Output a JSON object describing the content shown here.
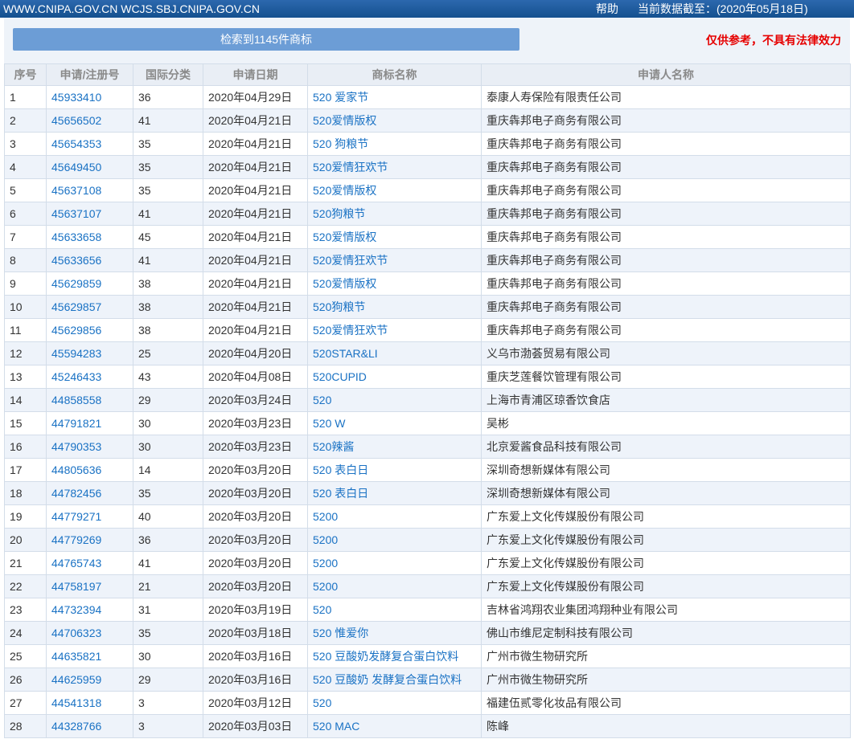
{
  "topbar": {
    "site_text": "WWW.CNIPA.GOV.CN WCJS.SBJ.CNIPA.GOV.CN",
    "help_label": "帮助",
    "data_date_label": "当前数据截至：(2020年05月18日)"
  },
  "toolbar": {
    "result_label": "检索到1145件商标",
    "disclaimer": "仅供参考，不具有法律效力"
  },
  "colors": {
    "topbar_top": "#2c68ae",
    "topbar_bottom": "#14508f",
    "button": "#6c9dd6",
    "disclaimer": "#e60000",
    "link": "#1a72c4",
    "row_alt": "#eef3fa"
  },
  "table": {
    "columns": [
      "序号",
      "申请/注册号",
      "国际分类",
      "申请日期",
      "商标名称",
      "申请人名称"
    ],
    "rows": [
      {
        "no": "1",
        "reg_no": "45933410",
        "intl_class": "36",
        "date": "2020年04月29日",
        "mark": "520 爱家节",
        "applicant": "泰康人寿保险有限责任公司"
      },
      {
        "no": "2",
        "reg_no": "45656502",
        "intl_class": "41",
        "date": "2020年04月21日",
        "mark": "520爱情版权",
        "applicant": "重庆犇邦电子商务有限公司"
      },
      {
        "no": "3",
        "reg_no": "45654353",
        "intl_class": "35",
        "date": "2020年04月21日",
        "mark": "520 狗粮节",
        "applicant": "重庆犇邦电子商务有限公司"
      },
      {
        "no": "4",
        "reg_no": "45649450",
        "intl_class": "35",
        "date": "2020年04月21日",
        "mark": "520爱情狂欢节",
        "applicant": "重庆犇邦电子商务有限公司"
      },
      {
        "no": "5",
        "reg_no": "45637108",
        "intl_class": "35",
        "date": "2020年04月21日",
        "mark": "520爱情版权",
        "applicant": "重庆犇邦电子商务有限公司"
      },
      {
        "no": "6",
        "reg_no": "45637107",
        "intl_class": "41",
        "date": "2020年04月21日",
        "mark": "520狗粮节",
        "applicant": "重庆犇邦电子商务有限公司"
      },
      {
        "no": "7",
        "reg_no": "45633658",
        "intl_class": "45",
        "date": "2020年04月21日",
        "mark": "520爱情版权",
        "applicant": "重庆犇邦电子商务有限公司"
      },
      {
        "no": "8",
        "reg_no": "45633656",
        "intl_class": "41",
        "date": "2020年04月21日",
        "mark": "520爱情狂欢节",
        "applicant": "重庆犇邦电子商务有限公司"
      },
      {
        "no": "9",
        "reg_no": "45629859",
        "intl_class": "38",
        "date": "2020年04月21日",
        "mark": "520爱情版权",
        "applicant": "重庆犇邦电子商务有限公司"
      },
      {
        "no": "10",
        "reg_no": "45629857",
        "intl_class": "38",
        "date": "2020年04月21日",
        "mark": "520狗粮节",
        "applicant": "重庆犇邦电子商务有限公司"
      },
      {
        "no": "11",
        "reg_no": "45629856",
        "intl_class": "38",
        "date": "2020年04月21日",
        "mark": "520爱情狂欢节",
        "applicant": "重庆犇邦电子商务有限公司"
      },
      {
        "no": "12",
        "reg_no": "45594283",
        "intl_class": "25",
        "date": "2020年04月20日",
        "mark": "520STAR&LI",
        "applicant": "义乌市渤荟贸易有限公司"
      },
      {
        "no": "13",
        "reg_no": "45246433",
        "intl_class": "43",
        "date": "2020年04月08日",
        "mark": "520CUPID",
        "applicant": "重庆芝莲餐饮管理有限公司"
      },
      {
        "no": "14",
        "reg_no": "44858558",
        "intl_class": "29",
        "date": "2020年03月24日",
        "mark": "520",
        "applicant": "上海市青浦区琼香饮食店"
      },
      {
        "no": "15",
        "reg_no": "44791821",
        "intl_class": "30",
        "date": "2020年03月23日",
        "mark": "520 W",
        "applicant": "吴彬"
      },
      {
        "no": "16",
        "reg_no": "44790353",
        "intl_class": "30",
        "date": "2020年03月23日",
        "mark": "520辣酱",
        "applicant": "北京爱酱食品科技有限公司"
      },
      {
        "no": "17",
        "reg_no": "44805636",
        "intl_class": "14",
        "date": "2020年03月20日",
        "mark": "520 表白日",
        "applicant": "深圳奇想新媒体有限公司"
      },
      {
        "no": "18",
        "reg_no": "44782456",
        "intl_class": "35",
        "date": "2020年03月20日",
        "mark": "520 表白日",
        "applicant": "深圳奇想新媒体有限公司"
      },
      {
        "no": "19",
        "reg_no": "44779271",
        "intl_class": "40",
        "date": "2020年03月20日",
        "mark": "5200",
        "applicant": "广东爱上文化传媒股份有限公司"
      },
      {
        "no": "20",
        "reg_no": "44779269",
        "intl_class": "36",
        "date": "2020年03月20日",
        "mark": "5200",
        "applicant": "广东爱上文化传媒股份有限公司"
      },
      {
        "no": "21",
        "reg_no": "44765743",
        "intl_class": "41",
        "date": "2020年03月20日",
        "mark": "5200",
        "applicant": "广东爱上文化传媒股份有限公司"
      },
      {
        "no": "22",
        "reg_no": "44758197",
        "intl_class": "21",
        "date": "2020年03月20日",
        "mark": "5200",
        "applicant": "广东爱上文化传媒股份有限公司"
      },
      {
        "no": "23",
        "reg_no": "44732394",
        "intl_class": "31",
        "date": "2020年03月19日",
        "mark": "520",
        "applicant": "吉林省鸿翔农业集团鸿翔种业有限公司"
      },
      {
        "no": "24",
        "reg_no": "44706323",
        "intl_class": "35",
        "date": "2020年03月18日",
        "mark": "520 惟爱你",
        "applicant": "佛山市维尼定制科技有限公司"
      },
      {
        "no": "25",
        "reg_no": "44635821",
        "intl_class": "30",
        "date": "2020年03月16日",
        "mark": "520 豆酸奶发酵复合蛋白饮料",
        "applicant": "广州市微生物研究所"
      },
      {
        "no": "26",
        "reg_no": "44625959",
        "intl_class": "29",
        "date": "2020年03月16日",
        "mark": "520 豆酸奶 发酵复合蛋白饮料",
        "applicant": "广州市微生物研究所"
      },
      {
        "no": "27",
        "reg_no": "44541318",
        "intl_class": "3",
        "date": "2020年03月12日",
        "mark": "520",
        "applicant": "福建伍贰零化妆品有限公司"
      },
      {
        "no": "28",
        "reg_no": "44328766",
        "intl_class": "3",
        "date": "2020年03月03日",
        "mark": "520 MAC",
        "applicant": "陈峰"
      }
    ]
  }
}
